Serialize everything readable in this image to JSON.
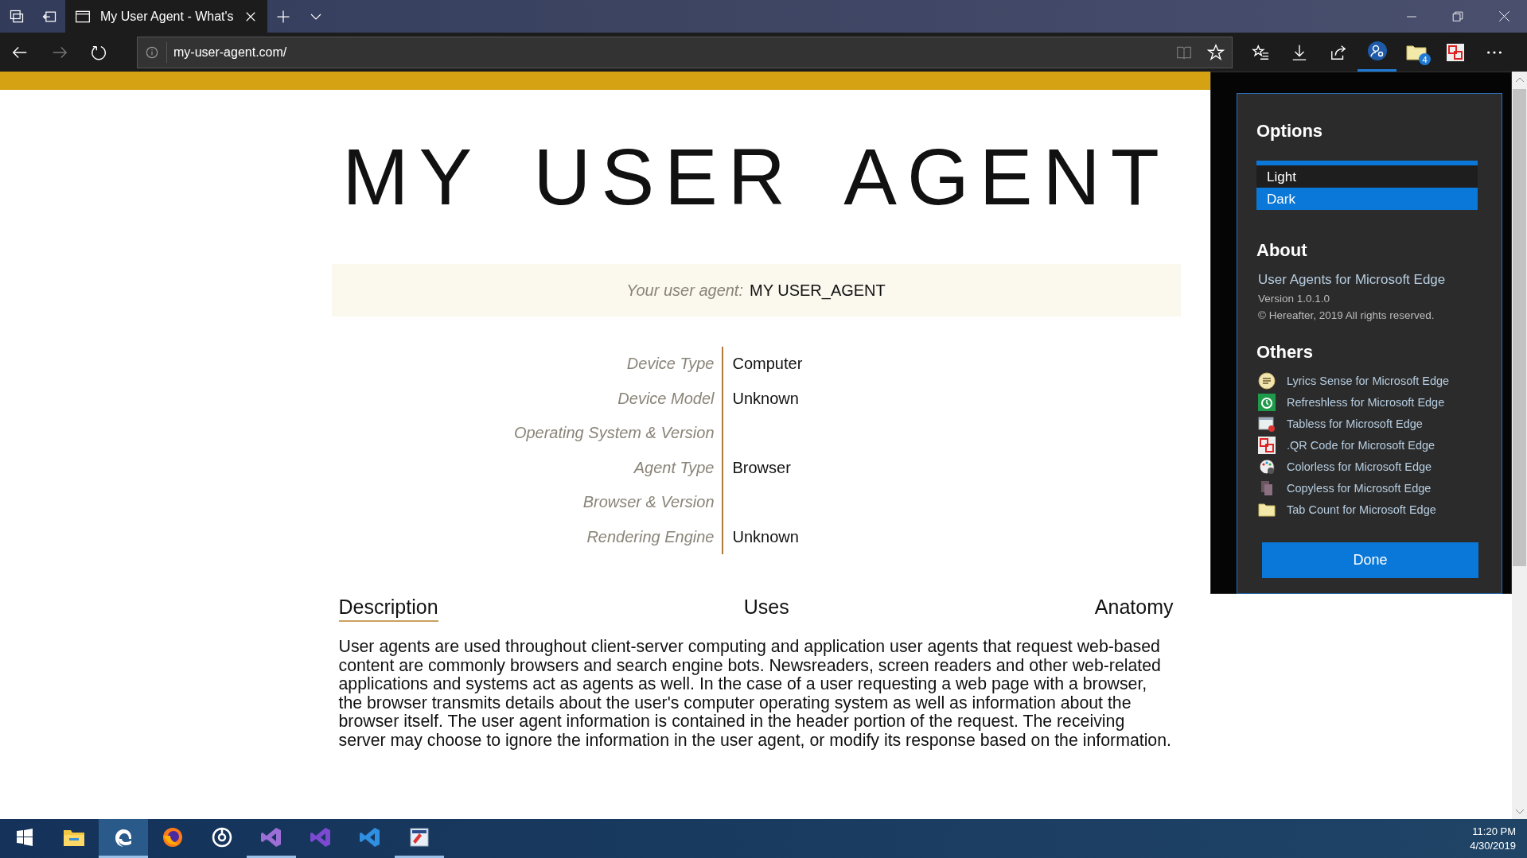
{
  "browser": {
    "tabs": [
      {
        "title": "My User Agent - What's",
        "selected": true
      }
    ],
    "address": "my-user-agent.com/",
    "extension_badge": "4"
  },
  "page": {
    "title": "MY USER AGENT",
    "user_agent": {
      "label": "Your user agent:",
      "value": "MY USER_AGENT"
    },
    "details": [
      {
        "label": "Device Type",
        "value": "Computer"
      },
      {
        "label": "Device Model",
        "value": "Unknown"
      },
      {
        "label": "Operating System & Version"
      },
      {
        "label": "Agent Type",
        "value": "Browser"
      },
      {
        "label": "Browser & Version"
      },
      {
        "label": "Rendering Engine",
        "value": "Unknown"
      }
    ],
    "sections": [
      {
        "label": "Description",
        "selected": true
      },
      {
        "label": "Uses",
        "selected": false
      },
      {
        "label": "Anatomy",
        "selected": false
      }
    ],
    "description": "User agents are used throughout client-server computing and application user agents that request web-based content are commonly browsers and search engine bots. Newsreaders, screen readers and other web-related applications and systems act as agents as well. In the case of a user requesting a web page with a browser, the browser transmits details about the user's computer operating system as well as information about the browser itself. The user agent information is contained in the header portion of the request. The receiving server may choose to ignore the information in the user agent, or modify its response based on the information."
  },
  "popup": {
    "options_heading": "Options",
    "themes": [
      {
        "label": "Light",
        "selected": false
      },
      {
        "label": "Dark",
        "selected": true
      }
    ],
    "about_heading": "About",
    "app_name": "User Agents for Microsoft Edge",
    "version": "Version 1.0.1.0",
    "copyright": "© Hereafter, 2019 All rights reserved.",
    "others_heading": "Others",
    "others": [
      {
        "label": "Lyrics Sense for Microsoft Edge"
      },
      {
        "label": "Refreshless for Microsoft Edge"
      },
      {
        "label": "Tabless for Microsoft Edge"
      },
      {
        "label": ".QR Code for Microsoft Edge"
      },
      {
        "label": "Colorless for Microsoft Edge"
      },
      {
        "label": "Copyless for Microsoft Edge"
      },
      {
        "label": "Tab Count for Microsoft Edge"
      }
    ],
    "done": "Done"
  },
  "taskbar": {
    "apps": [
      {
        "selected": false,
        "running": false
      },
      {
        "selected": false,
        "running": false
      },
      {
        "selected": true,
        "running": true
      },
      {
        "selected": false,
        "running": false
      },
      {
        "selected": false,
        "running": false
      },
      {
        "selected": false,
        "running": true
      },
      {
        "selected": false,
        "running": false
      },
      {
        "selected": false,
        "running": false
      },
      {
        "selected": false,
        "running": true
      }
    ],
    "time": "11:20 PM",
    "date": "4/30/2019"
  }
}
